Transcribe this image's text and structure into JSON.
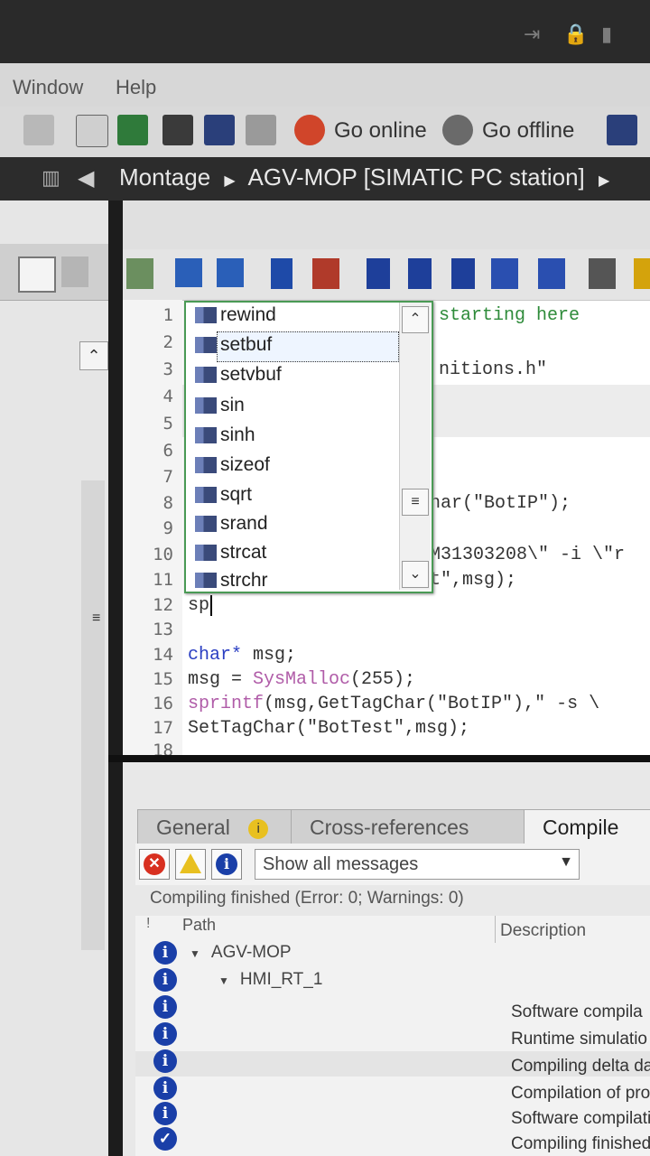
{
  "menu": {
    "window": "Window",
    "help": "Help"
  },
  "toolbar": {
    "go_online": "Go online",
    "go_offline": "Go offline"
  },
  "breadcrumb": {
    "part1": "Montage",
    "part2": "AGV-MOP [SIMATIC PC station]"
  },
  "editor": {
    "line_numbers": [
      "1",
      "2",
      "3",
      "4",
      "5",
      "6",
      "7",
      "8",
      "9",
      "10",
      "11",
      "12",
      "13",
      "14",
      "15",
      "16",
      "17",
      "18"
    ],
    "code": {
      "l1": "starting here",
      "l3": "nitions.h\"",
      "l8": "har(\"BotIP\");",
      "l10": "M31303208\\\" -i \\\"r",
      "l11": "t\",msg);",
      "l12": "sp",
      "l14_kw": "char*",
      "l14_rest": " msg;",
      "l15_a": "msg = ",
      "l15_fn": "SysMalloc",
      "l15_b": "(255);",
      "l16_fn": "sprintf",
      "l16_b": "(msg,GetTagChar(\"BotIP\"),\" -s \\",
      "l17": "SetTagChar(\"BotTest\",msg);"
    }
  },
  "autocomplete": {
    "items": [
      "rewind",
      "setbuf",
      "setvbuf",
      "sin",
      "sinh",
      "sizeof",
      "sqrt",
      "srand",
      "strcat",
      "strchr"
    ],
    "selected": "setbuf"
  },
  "inspector": {
    "tabs": {
      "general": "General",
      "cross_refs": "Cross-references",
      "compile": "Compile"
    },
    "filter": "Show all messages",
    "status": "Compiling finished (Error: 0; Warnings: 0)",
    "columns": {
      "flag": "!",
      "path": "Path",
      "description": "Description"
    },
    "tree": {
      "root": "AGV-MOP",
      "child": "HMI_RT_1"
    },
    "messages": [
      "Software compila",
      "Runtime simulatio",
      "Compiling delta da",
      "Compilation of pro",
      "Software compilati",
      "Compiling finished"
    ]
  }
}
